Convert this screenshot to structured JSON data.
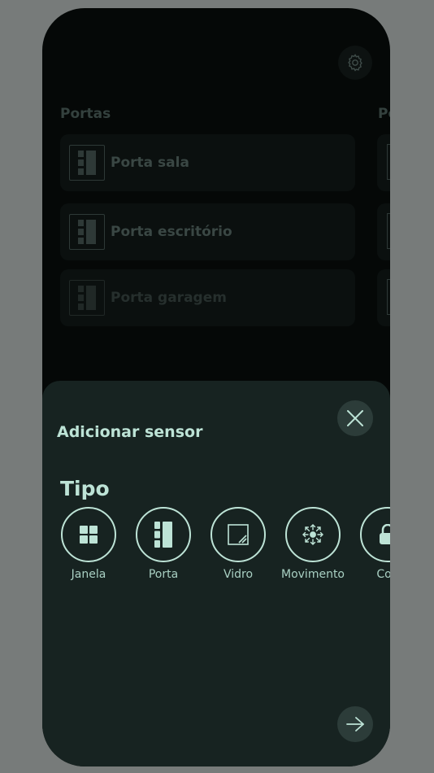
{
  "background_screen": {
    "sections": [
      {
        "title": "Portas"
      },
      {
        "title": "Po"
      }
    ],
    "doors": [
      {
        "name": "Porta sala"
      },
      {
        "name": "Porta escritório"
      },
      {
        "name": "Porta garagem"
      }
    ],
    "settings_icon": "gear-icon"
  },
  "sheet": {
    "title": "Adicionar sensor",
    "close_icon": "close-icon",
    "type_heading": "Tipo",
    "types": [
      {
        "label": "Janela",
        "icon": "window-icon"
      },
      {
        "label": "Porta",
        "icon": "door-icon"
      },
      {
        "label": "Vidro",
        "icon": "glass-icon"
      },
      {
        "label": "Movimento",
        "icon": "motion-icon"
      },
      {
        "label": "Con",
        "icon": "lock-icon"
      }
    ],
    "next_icon": "arrow-right-icon"
  },
  "colors": {
    "overlay": "#777b7a",
    "screen_bg": "#050807",
    "sheet_bg": "#172321",
    "accent": "#bde3d6",
    "button_bg": "#2c3c39"
  }
}
